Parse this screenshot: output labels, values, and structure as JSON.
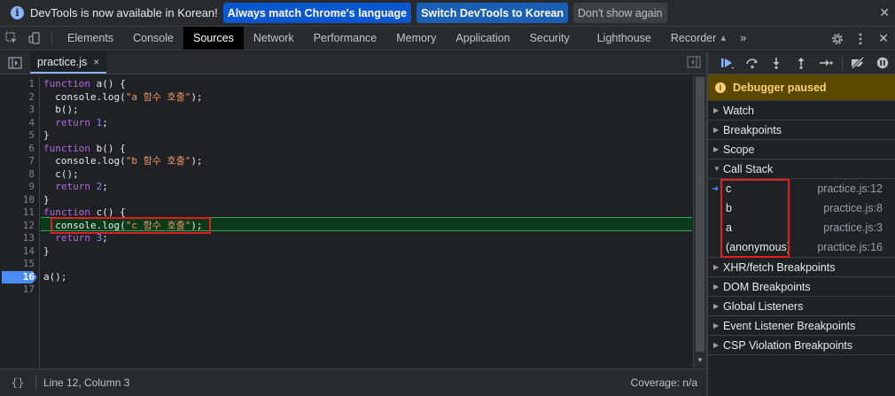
{
  "infobar": {
    "icon": "info-icon",
    "message": "DevTools is now available in Korean!",
    "btn_match": "Always match Chrome's language",
    "btn_switch": "Switch DevTools to Korean",
    "btn_dismiss": "Don't show again"
  },
  "tabs": {
    "elements": "Elements",
    "console": "Console",
    "sources": "Sources",
    "network": "Network",
    "performance": "Performance",
    "memory": "Memory",
    "application": "Application",
    "security": "Security",
    "lighthouse": "Lighthouse",
    "recorder": "Recorder",
    "more": "»"
  },
  "editor": {
    "file_name": "practice.js",
    "close_glyph": "×",
    "line_numbers": [
      "1",
      "2",
      "3",
      "4",
      "5",
      "6",
      "7",
      "8",
      "9",
      "10",
      "11",
      "12",
      "13",
      "14",
      "15",
      "16",
      "17"
    ],
    "breakpoint_line": "16",
    "current_line": "12"
  },
  "status": {
    "braces": "{}",
    "position": "Line 12, Column 3",
    "coverage": "Coverage: n/a"
  },
  "debugger": {
    "paused": "Debugger paused",
    "sections": {
      "watch": "Watch",
      "breakpoints": "Breakpoints",
      "scope": "Scope",
      "call_stack": "Call Stack",
      "xhr": "XHR/fetch Breakpoints",
      "dom": "DOM Breakpoints",
      "global": "Global Listeners",
      "event": "Event Listener Breakpoints",
      "csp": "CSP Violation Breakpoints"
    },
    "call_stack": [
      {
        "name": "c",
        "location": "practice.js:12"
      },
      {
        "name": "b",
        "location": "practice.js:8"
      },
      {
        "name": "a",
        "location": "practice.js:3"
      },
      {
        "name": "(anonymous)",
        "location": "practice.js:16"
      }
    ]
  },
  "colors": {
    "accent": "#8ab4f8",
    "breakpoint": "#4c8bf5",
    "paused_bg": "#5a4700",
    "highlight_box": "#e02020"
  }
}
